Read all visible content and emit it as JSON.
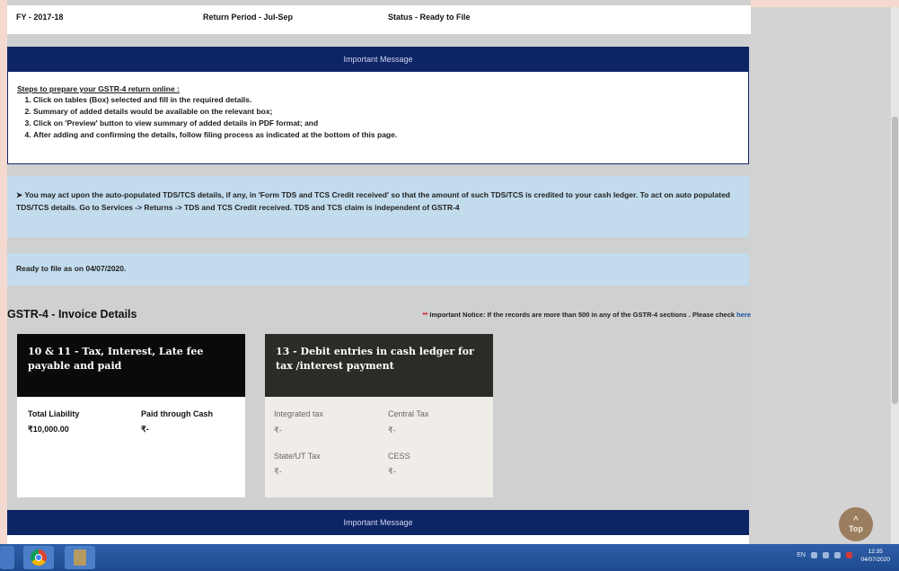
{
  "header": {
    "fy": "FY - 2017-18",
    "return_period": "Return Period - Jul-Sep",
    "status": "Status - Ready to File"
  },
  "important_message": {
    "title": "Important Message",
    "steps_title": "Steps to prepare your GSTR-4 return online :",
    "steps": [
      "Click on tables (Box) selected and fill in the required details.",
      "Summary of added details would be available on the relevant box;",
      "Click on 'Preview' button to view summary of added details in PDF format; and",
      "After adding and confirming the details, follow filing process as indicated at the bottom of this page."
    ]
  },
  "info_tds": {
    "icon": "info-circle-icon",
    "text": "You may act upon the auto-populated TDS/TCS details, if any, in 'Form TDS and TCS Credit received' so that the amount of such TDS/TCS is credited to your cash ledger. To act on auto populated TDS/TCS details. Go to Services -> Returns -> TDS and TCS Credit received. TDS and TCS claim is independent of GSTR-4"
  },
  "ready_text": "Ready to file as on 04/07/2020.",
  "section": {
    "title": "GSTR-4 - Invoice Details",
    "notice_stars": "**",
    "notice": " Important Notice: If the records are more than 500 in any of the GSTR-4 sections . Please check ",
    "notice_link": "here"
  },
  "cards": [
    {
      "title": "10 & 11 - Tax, Interest, Late fee payable and paid",
      "header_color": "#0a0a0a",
      "fields": [
        {
          "label": "Total Liability",
          "value": "₹10,000.00"
        },
        {
          "label": "Paid through Cash",
          "value": "₹-"
        }
      ]
    },
    {
      "title": "13 - Debit entries in cash ledger for tax /interest payment",
      "header_color": "#2b2b28",
      "fields": [
        {
          "label": "Integrated tax",
          "value": "₹-"
        },
        {
          "label": "Central Tax",
          "value": "₹-"
        },
        {
          "label": "State/UT Tax",
          "value": "₹-"
        },
        {
          "label": "CESS",
          "value": "₹-"
        }
      ]
    }
  ],
  "important_message_2": {
    "title": "Important Message"
  },
  "top_button": {
    "label": "Top",
    "icon": "chevron-up-icon"
  },
  "taskbar": {
    "language": "EN",
    "time": "12:35",
    "date": "04/07/2020"
  }
}
